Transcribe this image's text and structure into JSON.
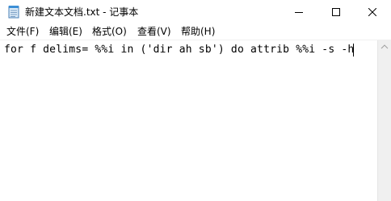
{
  "window": {
    "title": "新建文本文档.txt - 记事本",
    "app_icon": "notepad-icon",
    "controls": {
      "minimize_icon": "minimize-icon",
      "maximize_icon": "maximize-icon",
      "close_icon": "close-icon"
    }
  },
  "menu": {
    "items": [
      {
        "label": "文件(F)"
      },
      {
        "label": "编辑(E)"
      },
      {
        "label": "格式(O)"
      },
      {
        "label": "查看(V)"
      },
      {
        "label": "帮助(H)"
      }
    ]
  },
  "editor": {
    "lines": [
      "for f delims= %%i in ('dir ah sb') do attrib %%i -s -h"
    ]
  },
  "colors": {
    "background": "#ffffff",
    "scrollbar": "#f0f0f0"
  }
}
